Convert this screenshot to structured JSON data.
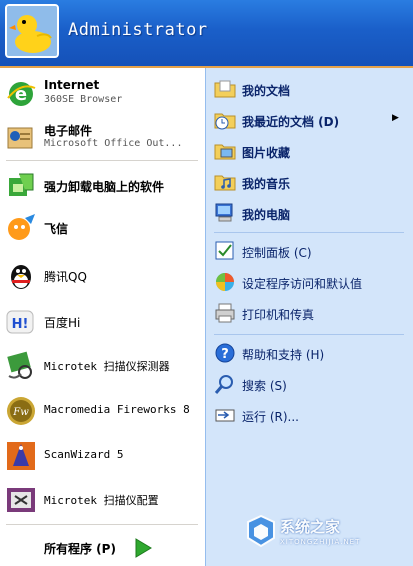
{
  "header": {
    "user_name": "Administrator"
  },
  "left": {
    "pinned": [
      {
        "title": "Internet",
        "subtitle": "360SE Browser",
        "icon": "browser-e-icon"
      },
      {
        "title": "电子邮件",
        "subtitle": "Microsoft Office Out...",
        "icon": "outlook-icon"
      }
    ],
    "recent": [
      {
        "label": "强力卸载电脑上的软件",
        "icon": "uninstaller-icon"
      },
      {
        "label": "飞信",
        "icon": "fetion-icon"
      },
      {
        "label": "腾讯QQ",
        "icon": "qq-penguin-icon"
      },
      {
        "label": "百度Hi",
        "icon": "baidu-hi-icon"
      },
      {
        "label": "Microtek 扫描仪探测器",
        "icon": "scanner-detector-icon"
      },
      {
        "label": "Macromedia Fireworks 8",
        "icon": "fireworks-icon"
      },
      {
        "label": "ScanWizard 5",
        "icon": "scanwizard-icon"
      },
      {
        "label": "Microtek 扫描仪配置",
        "icon": "scanner-config-icon"
      }
    ],
    "all_programs": "所有程序 (P)"
  },
  "right": {
    "group1": [
      {
        "label": "我的文档",
        "icon": "folder-documents-icon"
      },
      {
        "label": "我最近的文档 (D)",
        "icon": "recent-documents-icon",
        "submenu": true
      },
      {
        "label": "图片收藏",
        "icon": "folder-pictures-icon"
      },
      {
        "label": "我的音乐",
        "icon": "folder-music-icon"
      },
      {
        "label": "我的电脑",
        "icon": "my-computer-icon"
      }
    ],
    "group2": [
      {
        "label": "控制面板 (C)",
        "icon": "control-panel-icon"
      },
      {
        "label": "设定程序访问和默认值",
        "icon": "program-defaults-icon"
      },
      {
        "label": "打印机和传真",
        "icon": "printer-icon"
      }
    ],
    "group3": [
      {
        "label": "帮助和支持 (H)",
        "icon": "help-icon"
      },
      {
        "label": "搜索 (S)",
        "icon": "search-icon"
      },
      {
        "label": "运行 (R)...",
        "icon": "run-icon"
      }
    ]
  },
  "watermark": {
    "text": "系统之家",
    "sub": "XITONGZHIJIA.NET"
  },
  "colors": {
    "header": "#1a5fc9",
    "right_pane": "#d3e5fa",
    "accent_line": "#e6a24a",
    "go_arrow": "#2fa82f"
  }
}
